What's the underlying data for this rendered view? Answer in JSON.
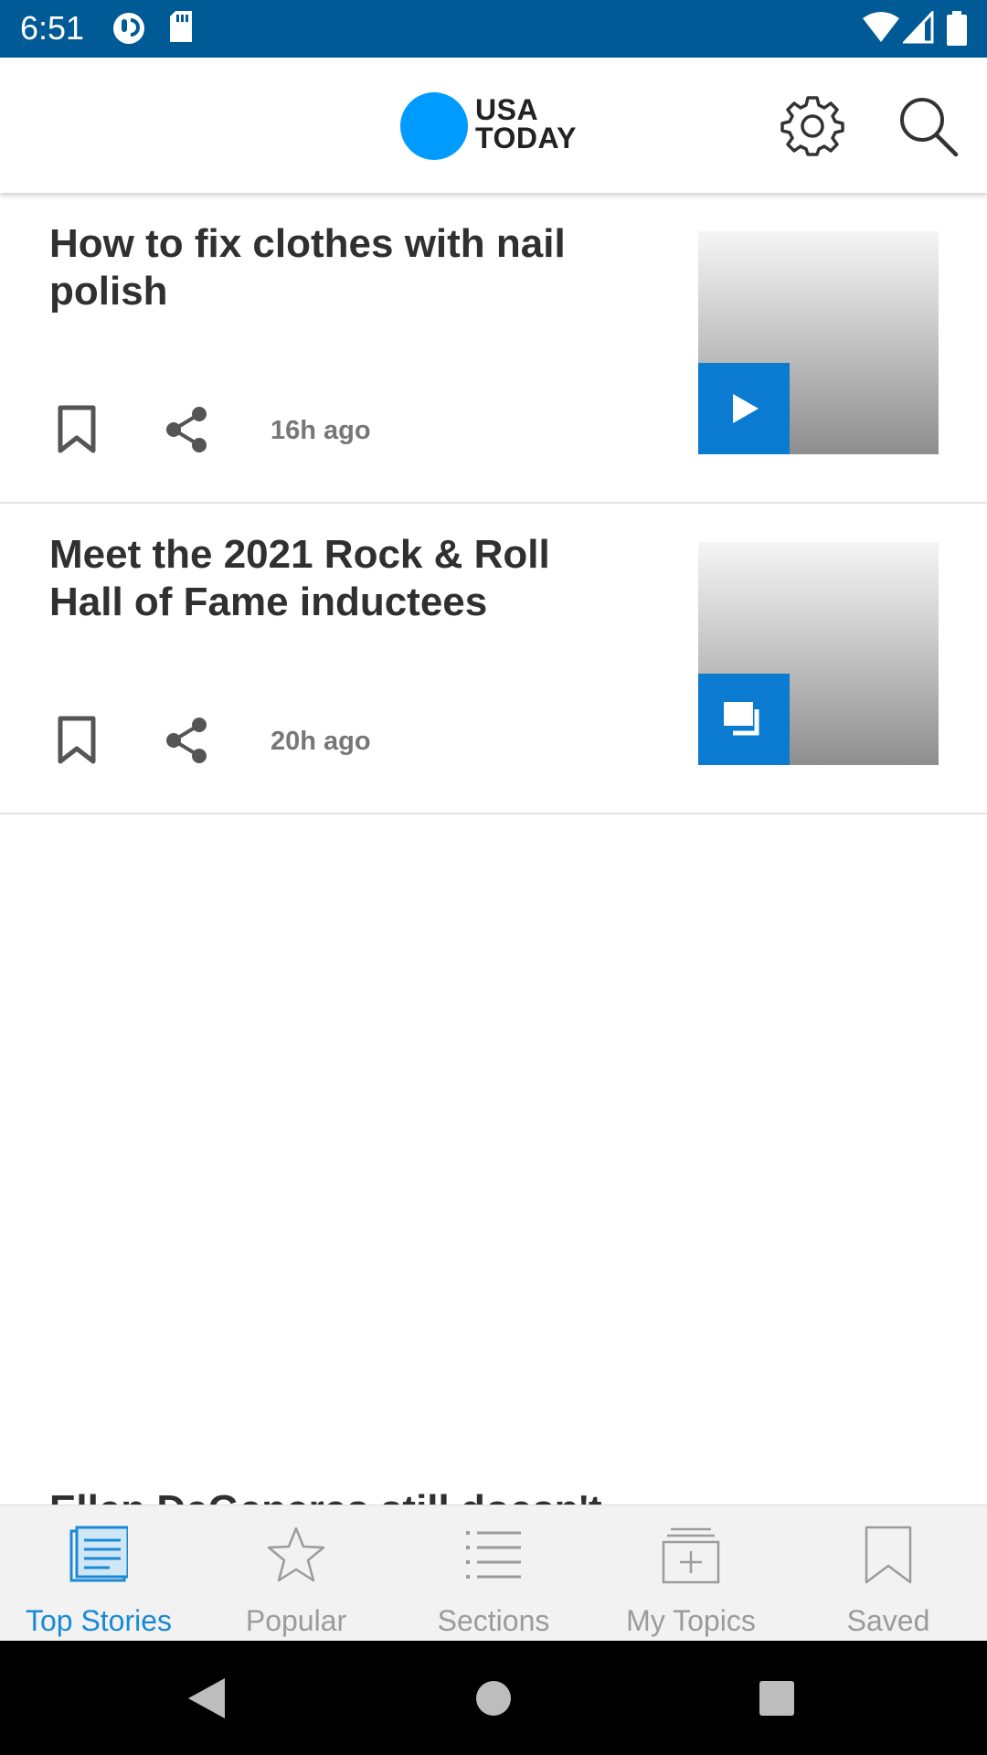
{
  "status_bar": {
    "time": "6:51",
    "bg_color": "#005a96"
  },
  "header": {
    "logo_line1": "USA",
    "logo_line2": "TODAY",
    "logo_color": "#009bff",
    "settings_icon": "gear-icon",
    "search_icon": "search-icon"
  },
  "stories": [
    {
      "headline": "How to fix clothes with nail polish",
      "time": "16h ago",
      "media_type": "video",
      "badge_icon": "play-icon"
    },
    {
      "headline": "Meet the 2021 Rock & Roll Hall of Fame inductees",
      "time": "20h ago",
      "media_type": "gallery",
      "badge_icon": "gallery-icon"
    }
  ],
  "partial_story": {
    "headline": "Ellen DeGeneres still doesn't"
  },
  "bottom_nav": {
    "items": [
      {
        "label": "Top Stories",
        "icon": "newspaper-icon",
        "active": true
      },
      {
        "label": "Popular",
        "icon": "star-icon",
        "active": false
      },
      {
        "label": "Sections",
        "icon": "list-icon",
        "active": false
      },
      {
        "label": "My Topics",
        "icon": "topics-icon",
        "active": false
      },
      {
        "label": "Saved",
        "icon": "bookmark-icon",
        "active": false
      }
    ],
    "active_color": "#1a8ad6",
    "inactive_color": "#9b9b9b"
  },
  "accent_color": "#0a7bd0"
}
